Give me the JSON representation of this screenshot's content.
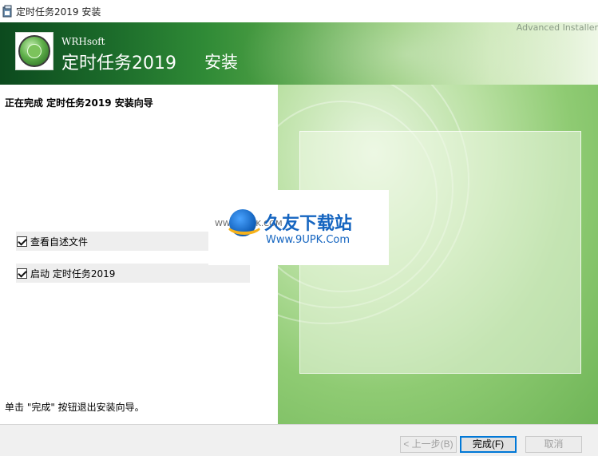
{
  "window": {
    "title": "定时任务2019 安装"
  },
  "banner": {
    "brand": "WRHsoft",
    "product": "定时任务2019",
    "subtitle": "安装",
    "installer_brand": "Advanced Installer"
  },
  "content": {
    "heading": "正在完成 定时任务2019 安装向导",
    "checkboxes": [
      {
        "label": "查看自述文件",
        "checked": true
      },
      {
        "label": "启动 定时任务2019",
        "checked": true
      }
    ],
    "footer_text": "单击 \"完成\" 按钮退出安装向导。"
  },
  "watermark": {
    "url_top": "WWW.9UPK.COM",
    "name": "久友下载站",
    "url": "Www.9UPK.Com"
  },
  "buttons": {
    "back": "< 上一步(B)",
    "finish": "完成(F)",
    "cancel": "取消"
  },
  "colors": {
    "accent": "#0078d7",
    "banner_dark": "#0c4a1e",
    "banner_light": "#eef7e6"
  },
  "icons": {
    "app": "installer-icon",
    "logo": "globe-logo-icon",
    "watermark_logo": "9upk-logo-icon"
  }
}
